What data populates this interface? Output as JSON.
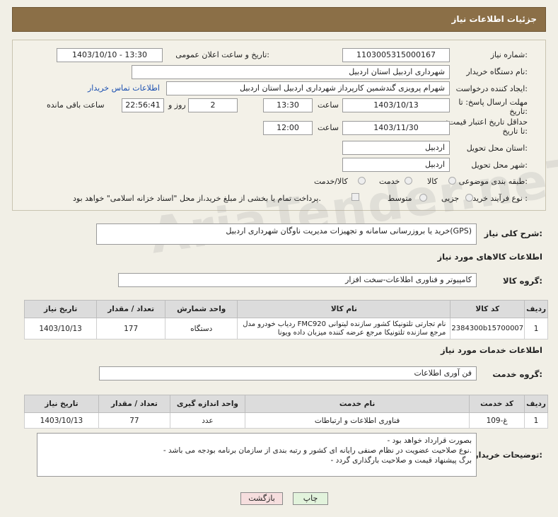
{
  "header": {
    "title": "جزئیات اطلاعات نیاز"
  },
  "form": {
    "need_number_label": "شماره نیاز:",
    "need_number": "1103005315000167",
    "announce_label": "تاریخ و ساعت اعلان عمومی:",
    "announce_value": "1403/10/10 - 13:30",
    "buyer_label": "نام دستگاه خریدار:",
    "buyer_value": "شهرداری اردبیل استان اردبیل",
    "creator_label": "ایجاد کننده درخواست:",
    "creator_value": "شهرام پرویزی گندشمین کارپرداز شهرداری اردبیل استان اردبیل",
    "contact_link": "اطلاعات تماس خریدار",
    "deadline_label": "مهلت ارسال پاسخ: تا تاریخ:",
    "deadline_date": "1403/10/13",
    "time_word": "ساعت",
    "deadline_time": "13:30",
    "days_value": "2",
    "days_word": "روز و",
    "remaining_value": "22:56:41",
    "remaining_word": "ساعت باقی مانده",
    "validity_label": "حداقل تاریخ اعتبار قیمت: تا تاریخ:",
    "validity_date": "1403/11/30",
    "validity_time": "12:00",
    "province_label": "استان محل تحویل:",
    "province_value": "اردبیل",
    "city_label": "شهر محل تحویل:",
    "city_value": "اردبیل",
    "category_label": "طبقه بندی موضوعی:",
    "category_options": [
      "کالا",
      "خدمت",
      "کالا/خدمت"
    ],
    "process_label": "نوع فرآیند خرید :",
    "process_options": [
      "جزیی",
      "متوسط"
    ],
    "payment_note": "پرداخت تمام یا بخشی از مبلغ خرید،از محل \"اسناد خزانه اسلامی\" خواهد بود."
  },
  "summary": {
    "label": "شرح کلی نیاز:",
    "value": "خرید یا بروزرسانی سامانه و تجهیزات مدیریت ناوگان شهرداری اردبیل(GPS)"
  },
  "goods": {
    "section_title": "اطلاعات کالاهای مورد نیاز",
    "group_label": "گروه کالا:",
    "group_value": "کامپیوتر و فناوری اطلاعات-سخت افزار",
    "headers": [
      "ردیف",
      "کد کالا",
      "نام کالا",
      "واحد شمارش",
      "تعداد / مقدار",
      "تاریخ نیاز"
    ],
    "rows": [
      {
        "idx": "1",
        "code": "2384300b15700007",
        "name": "ردیاب خودرو مدل FMC920 نام تجارتی تلتونیکا کشور سازنده لیتوانی مرجع سازنده تلتونیکا مرجع عرضه کننده میزبان داده ویونا",
        "unit": "دستگاه",
        "qty": "177",
        "date": "1403/10/13"
      }
    ]
  },
  "services": {
    "section_title": "اطلاعات خدمات مورد نیاز",
    "group_label": "گروه خدمت:",
    "group_value": "فن آوری اطلاعات",
    "headers": [
      "ردیف",
      "کد خدمت",
      "نام خدمت",
      "واحد اندازه گیری",
      "تعداد / مقدار",
      "تاریخ نیاز"
    ],
    "rows": [
      {
        "idx": "1",
        "code": "غ-109",
        "name": "فناوری اطلاعات و ارتباطات",
        "unit": "عدد",
        "qty": "77",
        "date": "1403/10/13"
      }
    ]
  },
  "notes": {
    "label": "توضیحات خریدار:",
    "lines": [
      "- بصورت قرارداد خواهد بود",
      "- نوع صلاحیت عضویت در نظام صنفی رایانه ای کشور و رتبه بندی از سازمان برنامه بودجه می باشد.",
      "- برگ پیشنهاد قیمت و صلاحیت بارگذاری گردد"
    ]
  },
  "buttons": {
    "print": "چاپ",
    "back": "بازگشت"
  },
  "watermark": "AriaTender.neT",
  "colors": {
    "header": "#8b6f47",
    "link": "#1a4fb0",
    "back_button": "#f6dede",
    "print_button": "#e2f3dc"
  }
}
